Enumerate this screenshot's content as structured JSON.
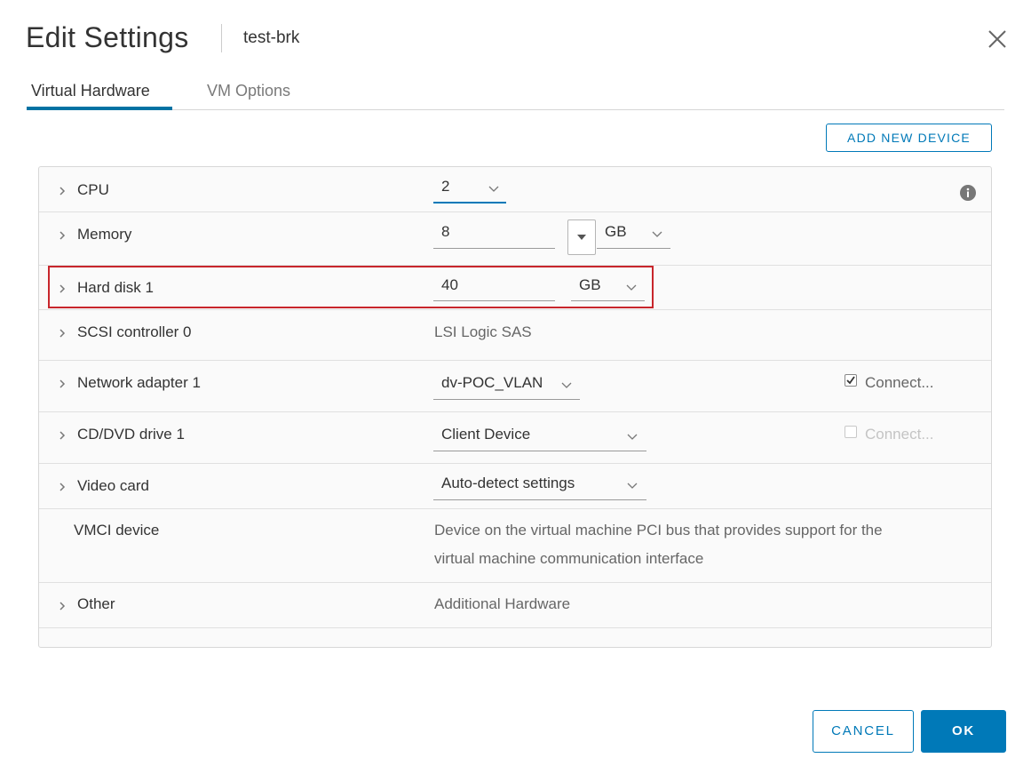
{
  "header": {
    "title": "Edit Settings",
    "vm_name": "test-brk"
  },
  "tabs": [
    {
      "label": "Virtual Hardware",
      "active": true
    },
    {
      "label": "VM Options",
      "active": false
    }
  ],
  "toolbar": {
    "add_new_device": "ADD NEW DEVICE"
  },
  "hardware": {
    "cpu": {
      "label": "CPU",
      "value": "2"
    },
    "memory": {
      "label": "Memory",
      "value": "8",
      "unit": "GB"
    },
    "hard_disk": {
      "label": "Hard disk 1",
      "value": "40",
      "unit": "GB"
    },
    "scsi": {
      "label": "SCSI controller 0",
      "value": "LSI Logic SAS"
    },
    "network": {
      "label": "Network adapter 1",
      "value": "dv-POC_VLAN",
      "connect_label": "Connect...",
      "connected": true
    },
    "cddvd": {
      "label": "CD/DVD drive 1",
      "value": "Client Device",
      "connect_label": "Connect...",
      "connected": false
    },
    "video": {
      "label": "Video card",
      "value": "Auto-detect settings"
    },
    "vmci": {
      "label": "VMCI device",
      "description_line1": "Device on the virtual machine PCI bus that provides support for the",
      "description_line2": "virtual machine communication interface"
    },
    "other": {
      "label": "Other",
      "value": "Additional Hardware"
    }
  },
  "footer": {
    "cancel": "CANCEL",
    "ok": "OK"
  },
  "colors": {
    "accent": "#0079b8",
    "highlight": "#c8262c"
  }
}
